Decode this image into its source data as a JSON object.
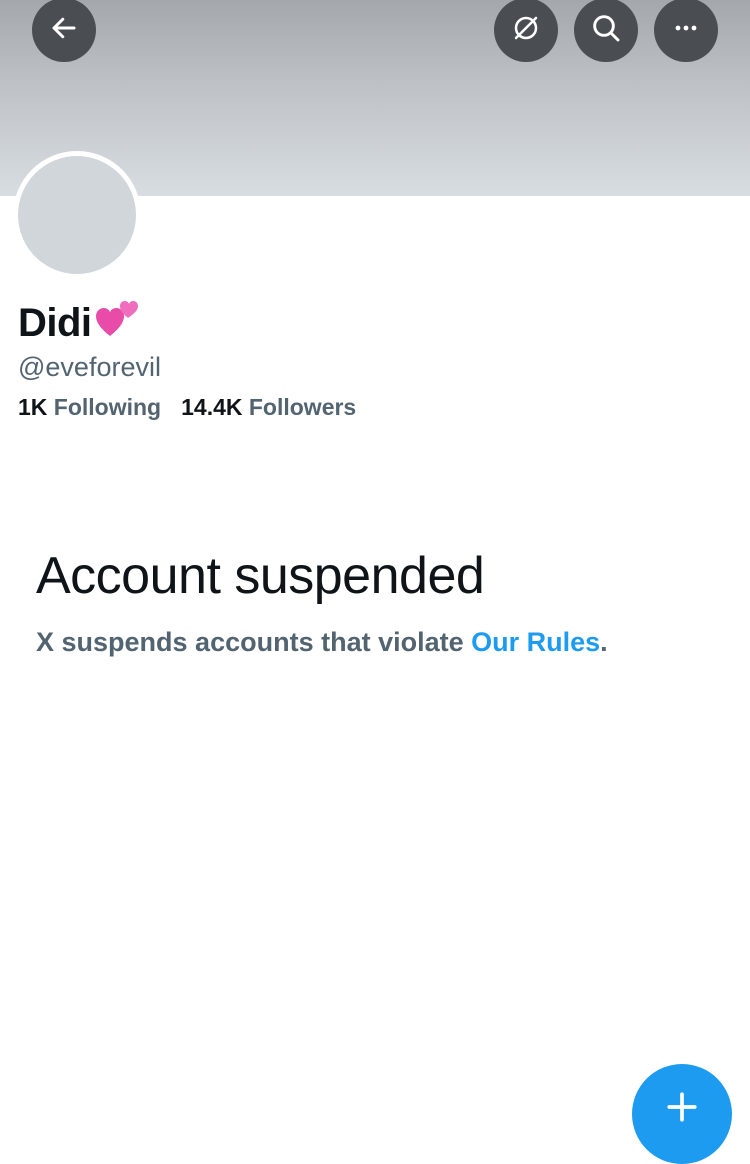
{
  "header": {
    "back_icon": "arrow-left-icon",
    "translate_icon": "globe-slash-icon",
    "search_icon": "search-icon",
    "more_icon": "more-horizontal-icon",
    "button_color": "#4a4e53"
  },
  "profile": {
    "display_name": "Didi",
    "name_emoji": "💕",
    "handle": "@eveforevil",
    "following_count": "1K",
    "following_label": "Following",
    "followers_count": "14.4K",
    "followers_label": "Followers"
  },
  "suspension": {
    "title": "Account suspended",
    "message": "X suspends accounts that violate ",
    "link_text": "Our Rules",
    "message_end": "."
  },
  "colors": {
    "link": "#1d9bf0",
    "secondary_text": "#536471",
    "primary_text": "#0f1419"
  },
  "fab": {
    "icon": "plus-icon"
  }
}
